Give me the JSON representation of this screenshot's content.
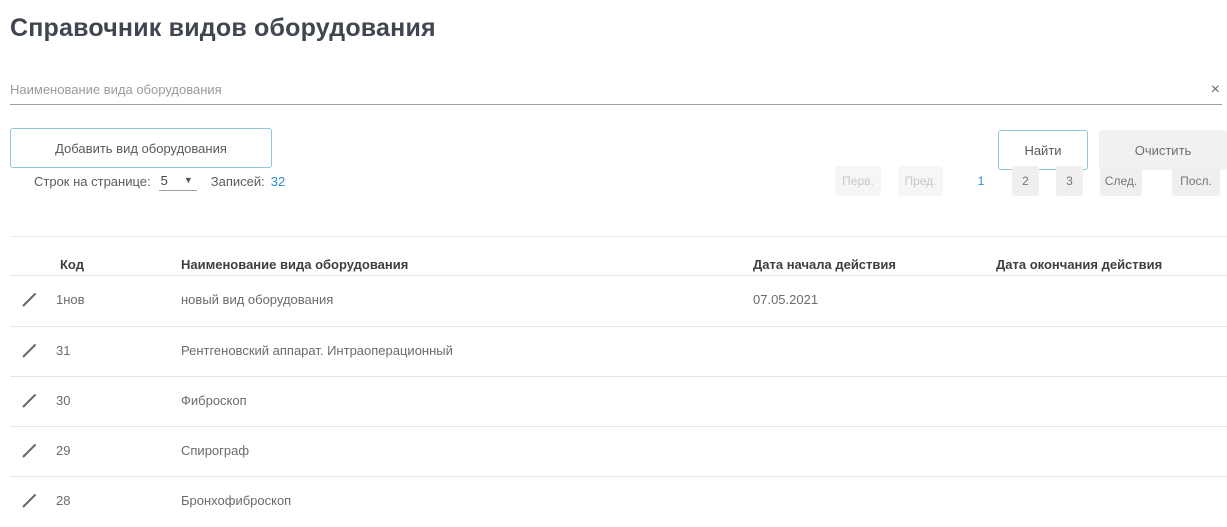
{
  "page": {
    "title": "Справочник видов оборудования"
  },
  "search": {
    "placeholder": "Наименование вида оборудования",
    "value": "",
    "clear_glyph": "×"
  },
  "toolbar": {
    "add_label": "Добавить вид оборудования",
    "find_label": "Найти",
    "clear_label": "Очистить"
  },
  "paging": {
    "rows_per_page_label": "Строк на странице:",
    "rows_per_page_value": "5",
    "records_label": "Записей:",
    "records_count": "32",
    "first": "Перв.",
    "prev": "Пред.",
    "pages": [
      "1",
      "2",
      "3"
    ],
    "current_page": "1",
    "next": "След.",
    "last": "Посл."
  },
  "table": {
    "columns": [
      "Код",
      "Наименование вида оборудования",
      "Дата начала действия",
      "Дата окончания действия"
    ],
    "rows": [
      {
        "code": "1нов",
        "name": "новый вид оборудования",
        "start": "07.05.2021",
        "end": ""
      },
      {
        "code": "31",
        "name": "Рентгеновский аппарат. Интраоперационный",
        "start": "",
        "end": ""
      },
      {
        "code": "30",
        "name": "Фиброскоп",
        "start": "",
        "end": ""
      },
      {
        "code": "29",
        "name": "Спирограф",
        "start": "",
        "end": ""
      },
      {
        "code": "28",
        "name": "Бронхофиброскоп",
        "start": "",
        "end": ""
      }
    ]
  },
  "icons": {
    "edit": "pencil-icon",
    "clear": "close-icon",
    "dropdown": "chevron-down-icon"
  },
  "colors": {
    "accent": "#2e8fcf",
    "button_border": "#8fc4dd",
    "title": "#404650"
  }
}
